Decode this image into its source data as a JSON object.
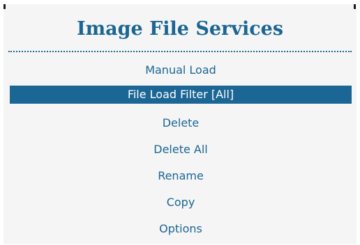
{
  "dialog": {
    "title": "Image File Services"
  },
  "menu": {
    "items": [
      {
        "label": "Manual Load"
      },
      {
        "label": "File Load Filter [All]",
        "selected": true
      },
      {
        "label": "Delete"
      },
      {
        "label": "Delete All"
      },
      {
        "label": "Rename"
      },
      {
        "label": "Copy"
      },
      {
        "label": "Options"
      }
    ]
  },
  "colors": {
    "accent": "#1b6694",
    "panel_background": "#f5f5f5",
    "selected_text": "#ffffff"
  }
}
